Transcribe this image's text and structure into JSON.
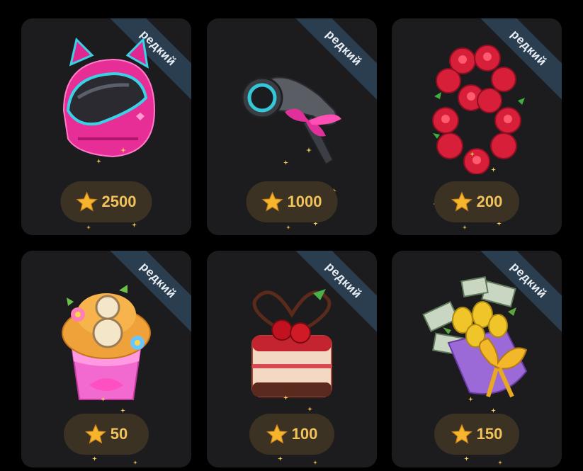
{
  "colors": {
    "card_bg": "#1c1c1e",
    "ribbon_bg": "#2b3e50",
    "price_bg": "#3b3224",
    "price_text": "#f2c25a"
  },
  "gifts": [
    {
      "badge": "редкий",
      "price": "2500",
      "icon": "pink-cat-helmet-icon"
    },
    {
      "badge": "редкий",
      "price": "1000",
      "icon": "hair-dryer-icon"
    },
    {
      "badge": "редкий",
      "price": "200",
      "icon": "rose-eight-icon"
    },
    {
      "badge": "редкий",
      "price": "50",
      "icon": "eight-cupcake-icon"
    },
    {
      "badge": "редкий",
      "price": "100",
      "icon": "cherry-cake-icon"
    },
    {
      "badge": "редкий",
      "price": "150",
      "icon": "money-bouquet-icon"
    }
  ]
}
